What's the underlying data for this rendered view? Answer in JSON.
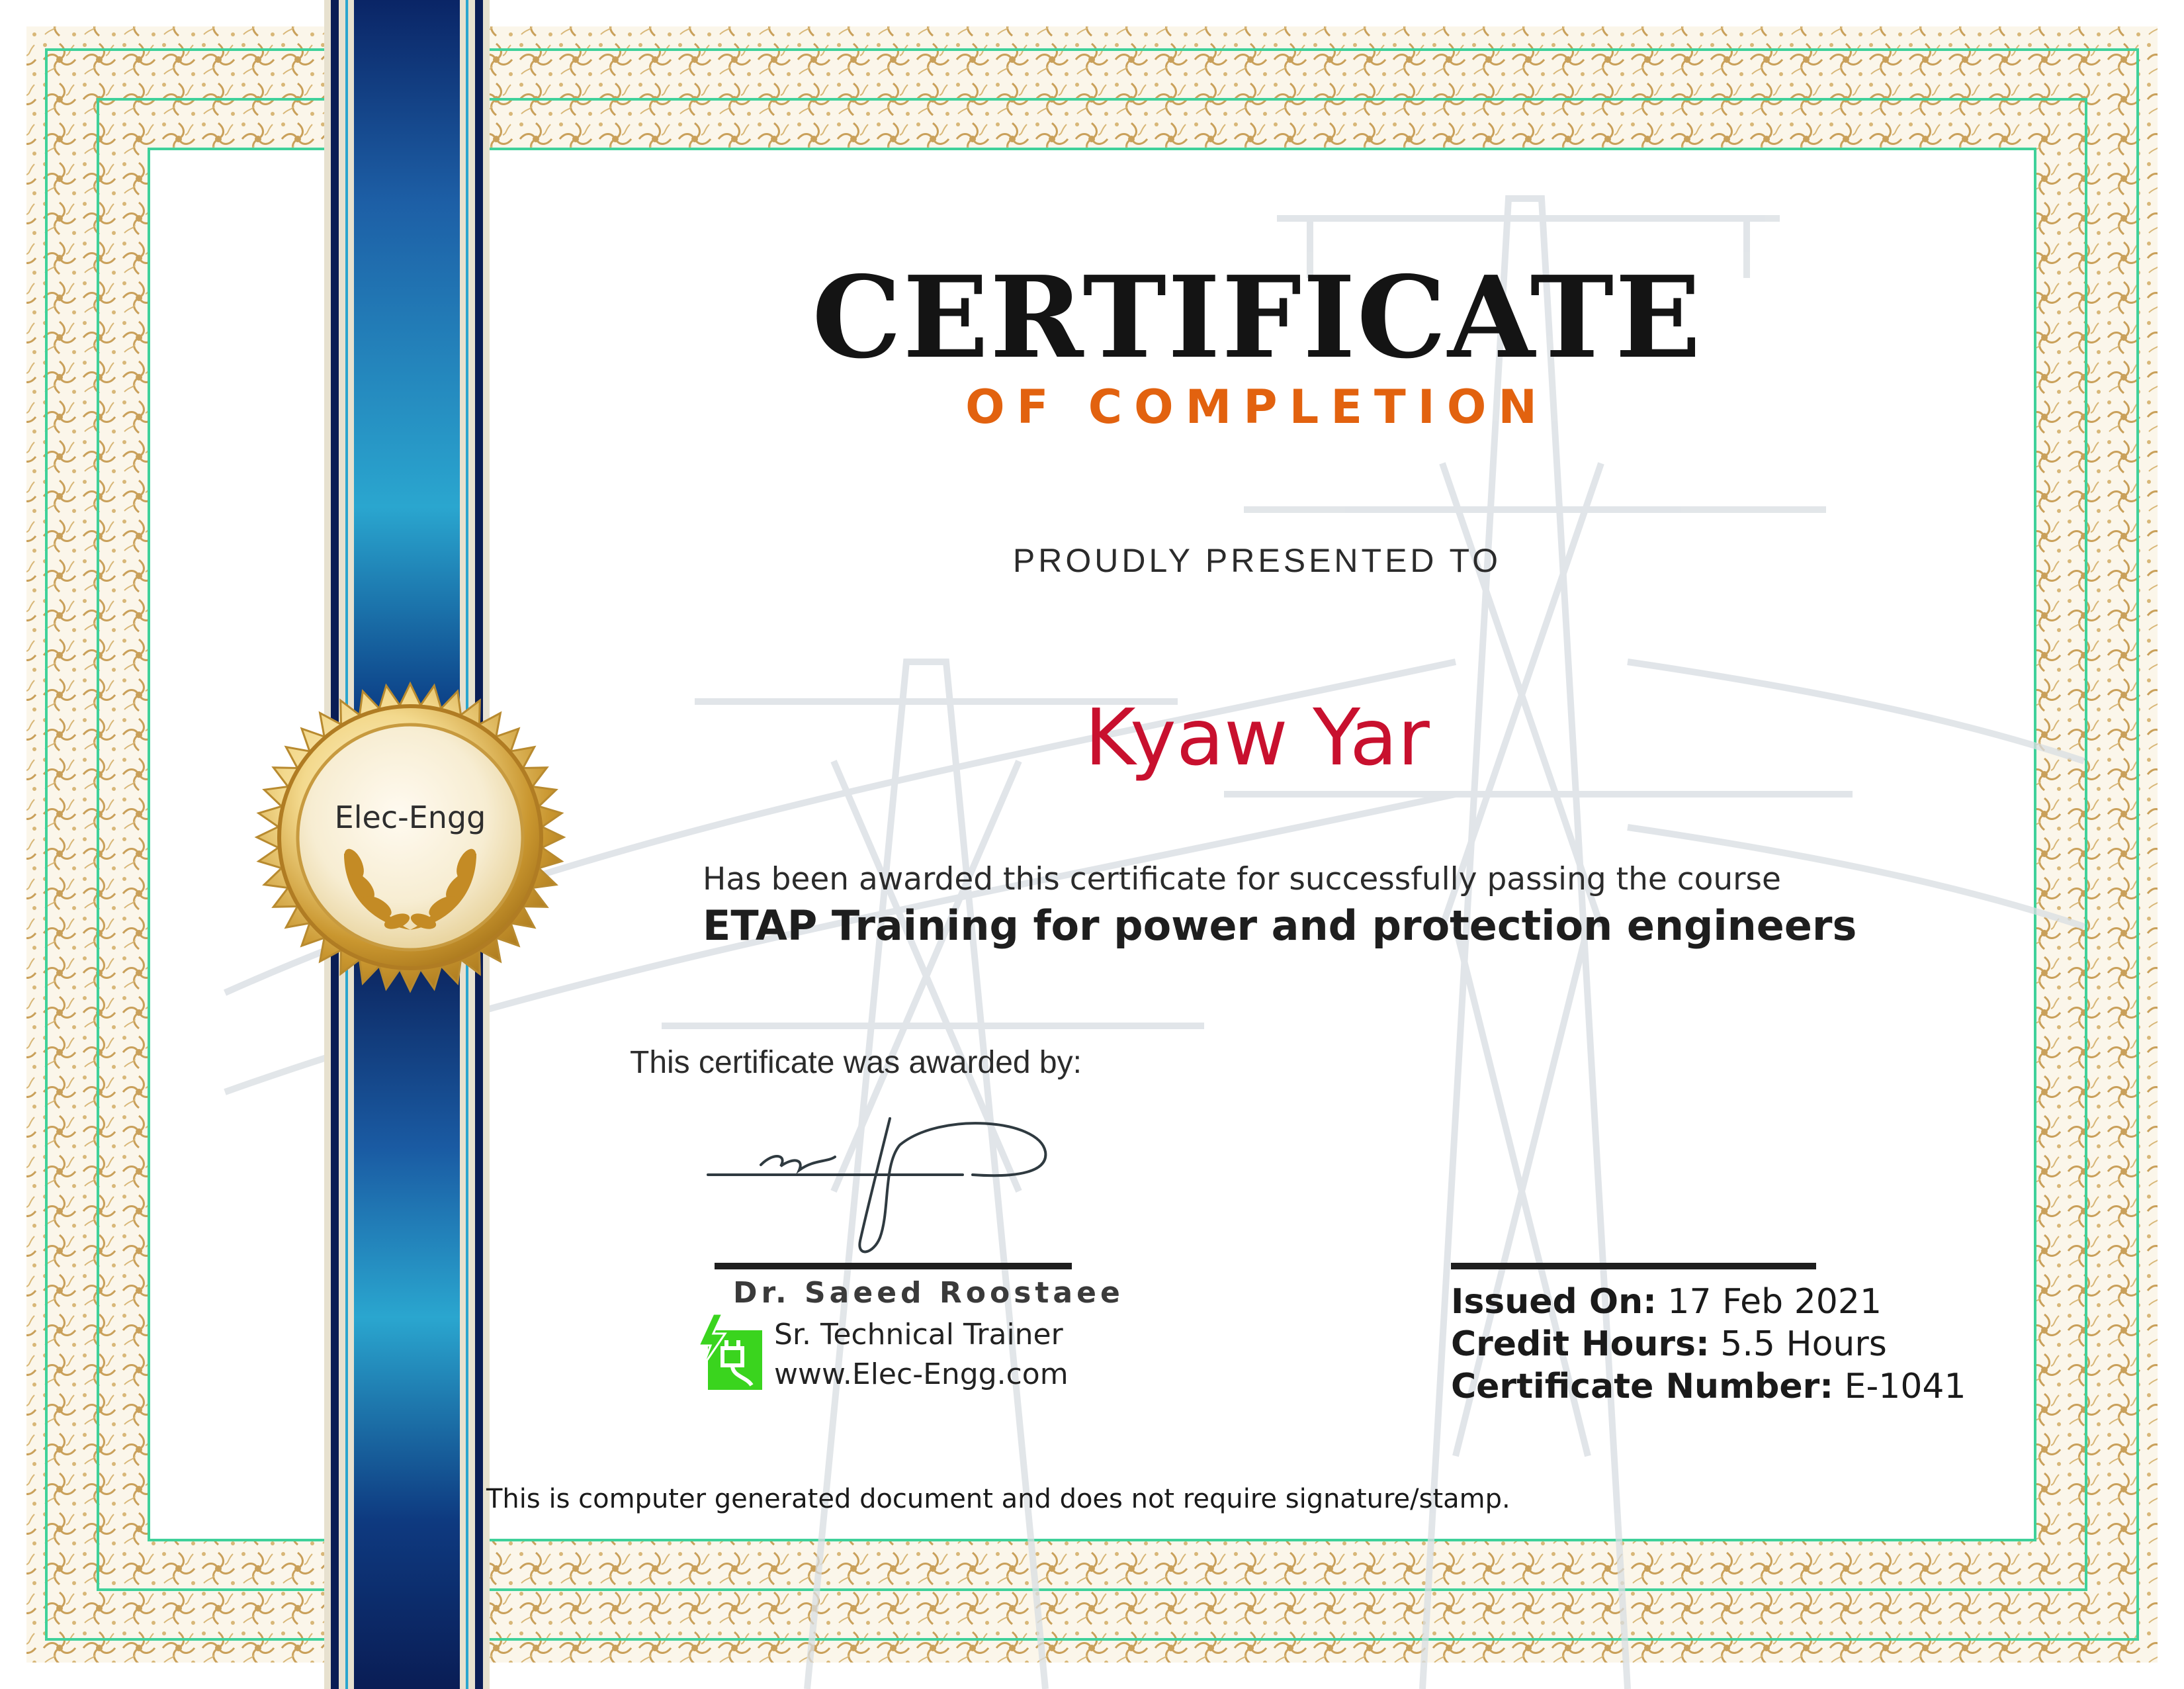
{
  "certificate": {
    "title": "CERTIFICATE",
    "subtitle": "OF COMPLETION",
    "presented_to_label": "PROUDLY PRESENTED TO",
    "recipient_name": "Kyaw Yar",
    "award_statement": "Has been awarded this certificate for successfully passing the course",
    "course_name": "ETAP Training for power and protection engineers",
    "awarded_by_label": "This certificate was awarded by:"
  },
  "seal": {
    "text": "Elec-Engg"
  },
  "signatory": {
    "name": "Dr. Saeed Roostaee",
    "title": "Sr. Technical Trainer",
    "website": "www.Elec-Engg.com",
    "logo_icon": "plug-lightning-icon"
  },
  "details": {
    "issued_on_label": "Issued On:",
    "issued_on_value": "17 Feb 2021",
    "credit_hours_label": "Credit Hours:",
    "credit_hours_value": "5.5 Hours",
    "certificate_number_label": "Certificate Number:",
    "certificate_number_value": "E-1041"
  },
  "footer_note": "This is computer generated document and does not require signature/stamp.",
  "colors": {
    "title": "#141414",
    "subtitle_orange": "#e2620f",
    "recipient_red": "#c8102e",
    "border_gold": "#c9a05a",
    "guide_teal": "#3fd19a",
    "ribbon_navy": "#0c2b6b",
    "ribbon_cyan": "#2aa6cf",
    "logo_green": "#3ad41e"
  }
}
